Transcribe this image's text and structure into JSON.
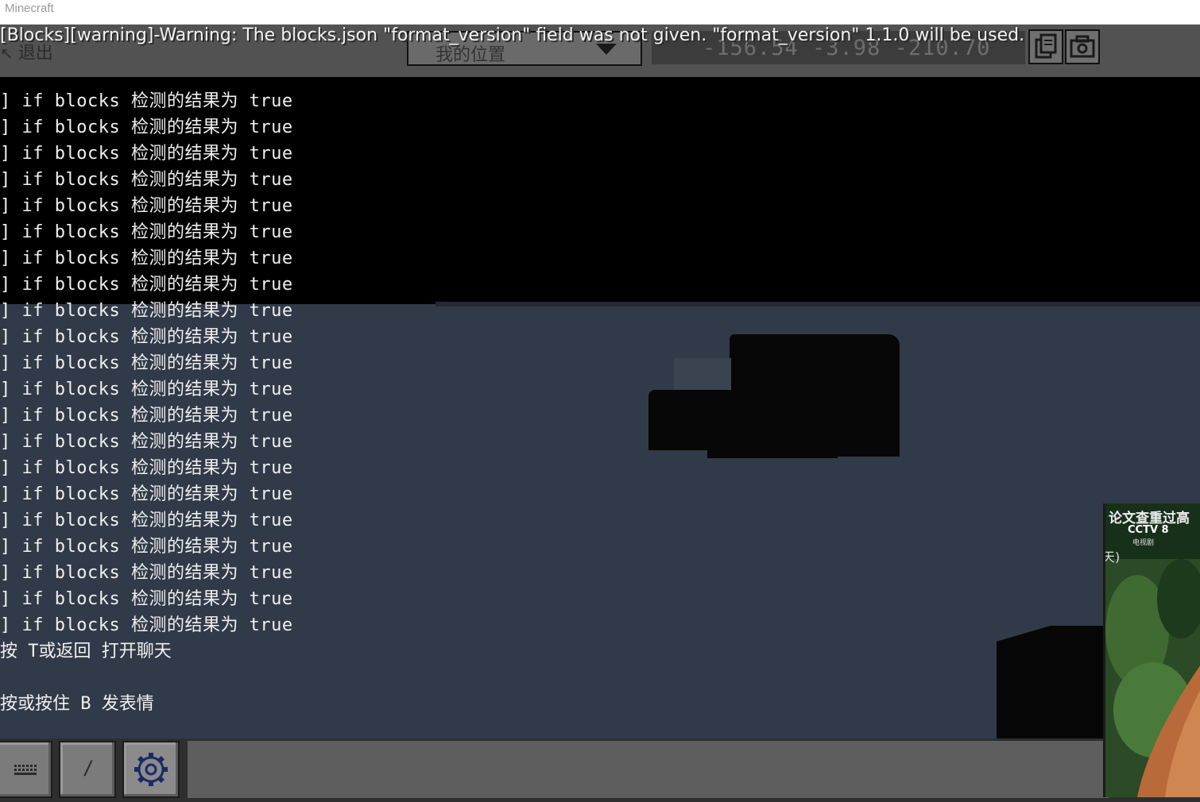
{
  "window": {
    "title": "Minecraft"
  },
  "topbar": {
    "exit_arrow": "↖",
    "exit_label": "退出",
    "location_dropdown": "我的位置",
    "coordinates": "-156.54 -3.98 -210.70",
    "warning": "[Blocks][warning]-Warning: The blocks.json \"format_version\" field was not given. \"format_version\" 1.1.0 will be used."
  },
  "chat": {
    "lines": [
      "] if blocks 检测的结果为 true",
      "] if blocks 检测的结果为 true",
      "] if blocks 检测的结果为 true",
      "] if blocks 检测的结果为 true",
      "] if blocks 检测的结果为 true",
      "] if blocks 检测的结果为 true",
      "] if blocks 检测的结果为 true",
      "] if blocks 检测的结果为 true",
      "] if blocks 检测的结果为 true",
      "] if blocks 检测的结果为 true",
      "] if blocks 检测的结果为 true",
      "] if blocks 检测的结果为 true",
      "] if blocks 检测的结果为 true",
      "] if blocks 检测的结果为 true",
      "] if blocks 检测的结果为 true",
      "] if blocks 检测的结果为 true",
      "] if blocks 检测的结果为 true",
      "] if blocks 检测的结果为 true",
      "] if blocks 检测的结果为 true",
      "] if blocks 检测的结果为 true",
      "] if blocks 检测的结果为 true"
    ],
    "hint_chat": "按 T或返回 打开聊天",
    "hint_emote": "按或按住 B 发表情"
  },
  "toolbar": {
    "keyboard_icon": "keyboard-icon",
    "slash_label": "/",
    "settings_icon": "gear-icon"
  },
  "video_overlay": {
    "caption": "论文查重过高",
    "channel": "CCTV 8",
    "channel_sub": "电视剧",
    "paren": "天)"
  },
  "colors": {
    "sky": "#000000",
    "ground": "#313a48",
    "chat_text": "#f0f0f0"
  }
}
